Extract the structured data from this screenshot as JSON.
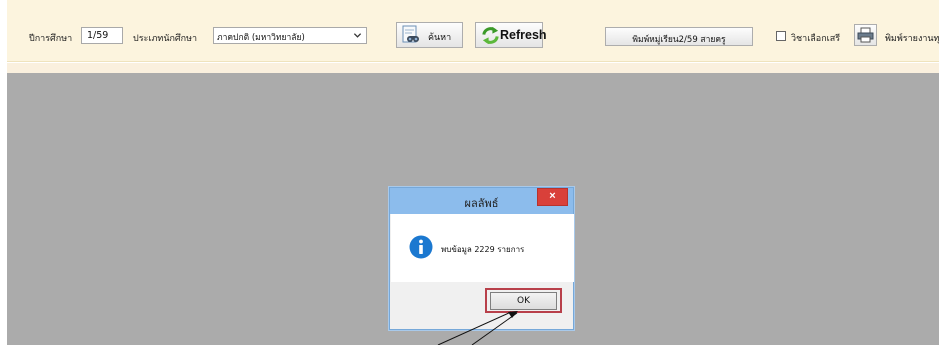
{
  "toolbar": {
    "year_label": "ปีการศึกษา",
    "year_value": "1/59",
    "type_label": "ประเภทนักศึกษา",
    "type_value": "ภาคปกติ (มหาวิทยาลัย)",
    "search_label": "ค้นหา",
    "refresh_label": "Refresh",
    "print_group_label": "พิมพ์หมู่เรียน2/59 สายครู",
    "elective_label": "วิชาเลือกเสรี",
    "elective_checked": false,
    "print_report_label": "พิมพ์รายงานทุ"
  },
  "dialog": {
    "title": "ผลลัพธ์",
    "close_glyph": "×",
    "message": "พบข้อมูล 2229 รายการ",
    "ok_label": "OK"
  },
  "colors": {
    "toolbar_bg": "#fcf4de",
    "content_bg": "#ababab",
    "dialog_titlebar": "#8cbcec",
    "close_button": "#d9403a",
    "highlight_border": "#b8404a",
    "info_icon": "#1b78d0"
  },
  "icons": {
    "search": "binoculars-icon",
    "refresh": "refresh-arrows-icon",
    "printer": "printer-icon",
    "info": "info-icon",
    "chevron": "chevron-down-icon"
  }
}
